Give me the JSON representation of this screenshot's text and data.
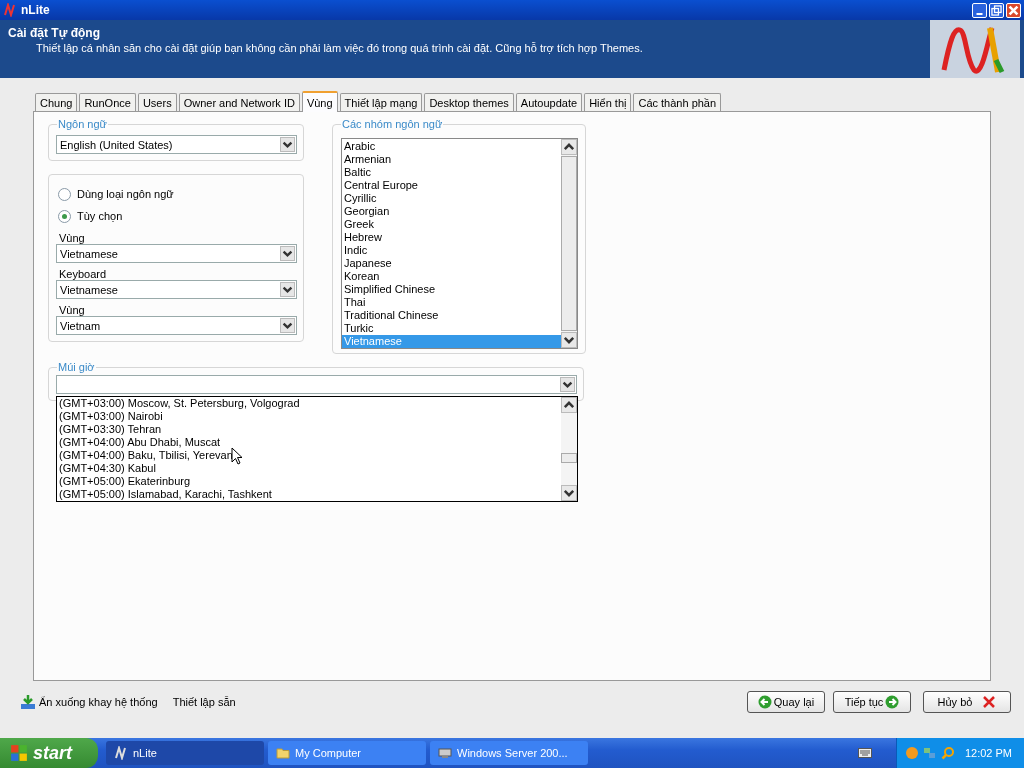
{
  "window": {
    "title": "nLite"
  },
  "header": {
    "title": "Cài đặt Tự động",
    "subtitle": "Thiết lập cá nhân săn cho cài đặt giúp bạn không cần phải làm việc đó trong quá trình cài đặt. Cũng hỗ trợ tích hợp Themes."
  },
  "tabs": [
    {
      "label": "Chung",
      "selected": false
    },
    {
      "label": "RunOnce",
      "selected": false
    },
    {
      "label": "Users",
      "selected": false
    },
    {
      "label": "Owner and Network ID",
      "selected": false
    },
    {
      "label": "Vùng",
      "selected": true
    },
    {
      "label": "Thiết lập mạng",
      "selected": false
    },
    {
      "label": "Desktop themes",
      "selected": false
    },
    {
      "label": "Autoupdate",
      "selected": false
    },
    {
      "label": "Hiển thị",
      "selected": false
    },
    {
      "label": "Các thành phần",
      "selected": false
    }
  ],
  "language": {
    "label": "Ngôn ngữ",
    "value": "English (United States)"
  },
  "region": {
    "radios": [
      {
        "label": "Dùng loại ngôn ngữ",
        "selected": false
      },
      {
        "label": "Tùy chọn",
        "selected": true
      }
    ],
    "fields": [
      {
        "label": "Vùng",
        "value": "Vietnamese"
      },
      {
        "label": "Keyboard",
        "value": "Vietnamese"
      },
      {
        "label": "Vùng",
        "value": "Vietnam"
      }
    ]
  },
  "language_groups": {
    "label": "Các nhóm ngôn ngữ",
    "items": [
      {
        "label": "Arabic",
        "selected": false
      },
      {
        "label": "Armenian",
        "selected": false
      },
      {
        "label": "Baltic",
        "selected": false
      },
      {
        "label": "Central Europe",
        "selected": false
      },
      {
        "label": "Cyrillic",
        "selected": false
      },
      {
        "label": "Georgian",
        "selected": false
      },
      {
        "label": "Greek",
        "selected": false
      },
      {
        "label": "Hebrew",
        "selected": false
      },
      {
        "label": "Indic",
        "selected": false
      },
      {
        "label": "Japanese",
        "selected": false
      },
      {
        "label": "Korean",
        "selected": false
      },
      {
        "label": "Simplified Chinese",
        "selected": false
      },
      {
        "label": "Thai",
        "selected": false
      },
      {
        "label": "Traditional Chinese",
        "selected": false
      },
      {
        "label": "Turkic",
        "selected": false
      },
      {
        "label": "Vietnamese",
        "selected": true
      }
    ]
  },
  "timezone": {
    "label": "Múi giờ",
    "options": [
      "(GMT+03:00) Moscow, St. Petersburg, Volgograd",
      "(GMT+03:00) Nairobi",
      "(GMT+03:30) Tehran",
      "(GMT+04:00) Abu Dhabi, Muscat",
      "(GMT+04:00) Baku, Tbilisi, Yerevan",
      "(GMT+04:30) Kabul",
      "(GMT+05:00) Ekaterinburg",
      "(GMT+05:00) Islamabad, Karachi, Tashkent"
    ]
  },
  "footer": {
    "tray_link": "Ẩn xuống khay hệ thống",
    "presets_link": "Thiết lập sẵn",
    "buttons": [
      {
        "label": "Quay lại",
        "kind": "back"
      },
      {
        "label": "Tiếp tục",
        "kind": "next"
      },
      {
        "label": "Hủy bỏ",
        "kind": "cancel"
      }
    ]
  },
  "taskbar": {
    "start": "start",
    "tasks": [
      {
        "label": "nLite",
        "selected": true,
        "kind": "app"
      },
      {
        "label": "My Computer",
        "selected": false,
        "kind": "folder"
      },
      {
        "label": "Windows Server 200...",
        "selected": false,
        "kind": "server"
      }
    ],
    "clock": "12:02 PM"
  }
}
